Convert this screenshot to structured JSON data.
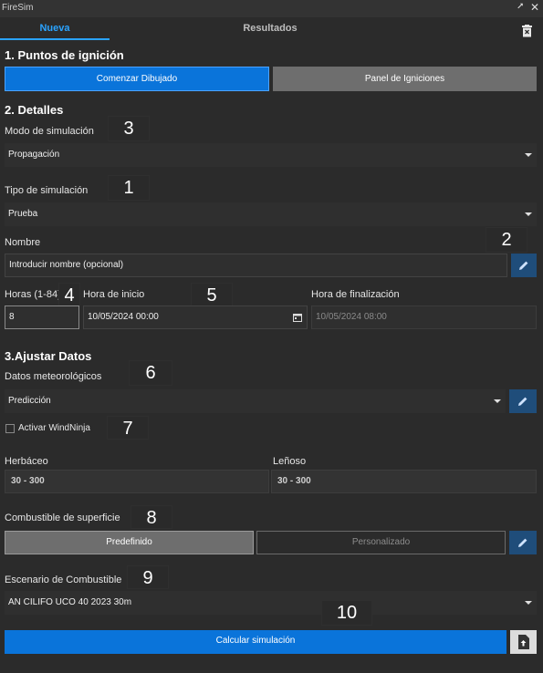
{
  "window": {
    "title": "FireSim",
    "pin_glyph": "⭧",
    "close_glyph": "✕"
  },
  "tabs": [
    {
      "label": "Nueva"
    },
    {
      "label": "Resultados"
    }
  ],
  "section1": {
    "title": "1. Puntos de ignición",
    "start_drawing": "Comenzar Dibujado",
    "ignitions_panel": "Panel de Igniciones"
  },
  "section2": {
    "title": "2. Detalles",
    "sim_mode": {
      "label": "Modo de simulación",
      "value": "Propagación"
    },
    "sim_type": {
      "label": "Tipo de simulación",
      "value": "Prueba"
    },
    "name": {
      "label": "Nombre",
      "placeholder": "Introducir nombre (opcional)"
    },
    "hours": {
      "label": "Horas (1-84)",
      "value": "8"
    },
    "start_time": {
      "label": "Hora de inicio",
      "value": "10/05/2024 00:00"
    },
    "end_time": {
      "label": "Hora de finalización",
      "value": "10/05/2024 08:00"
    }
  },
  "section3": {
    "title": "3.Ajustar Datos",
    "weather": {
      "label": "Datos meteorológicos",
      "value": "Predicción"
    },
    "windninja": {
      "label": "Activar WindNinja"
    },
    "herbaceo": {
      "label": "Herbáceo",
      "value": "30 - 300"
    },
    "lenoso": {
      "label": "Leñoso",
      "value": "30 - 300"
    },
    "surface_fuel": {
      "label": "Combustible de superficie",
      "predefined": "Predefinido",
      "custom": "Personalizado"
    },
    "fuel_scenario": {
      "label": "Escenario de Combustible",
      "value": "AN CILIFO UCO 40 2023 30m"
    }
  },
  "calculate": "Calcular simulación",
  "annotations": [
    "3",
    "1",
    "2",
    "4",
    "5",
    "6",
    "7",
    "8",
    "9",
    "10"
  ],
  "colors": {
    "accent": "#0a74da",
    "tab_active": "#2aa3ff",
    "background": "#2b2b2b"
  },
  "icons": [
    "trash-icon",
    "pencil-icon",
    "calendar-icon",
    "chevron-down-icon",
    "file-upload-icon"
  ]
}
